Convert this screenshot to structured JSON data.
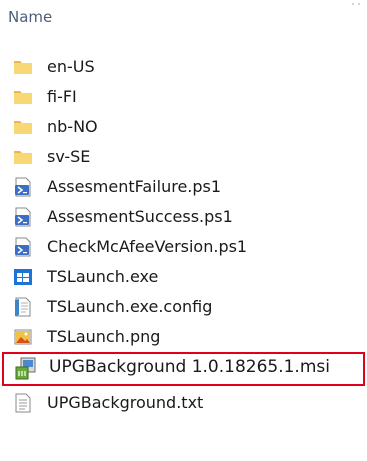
{
  "header": {
    "name_label": "Name"
  },
  "files": [
    {
      "name": "en-US",
      "icon": "folder-icon"
    },
    {
      "name": "fi-FI",
      "icon": "folder-icon"
    },
    {
      "name": "nb-NO",
      "icon": "folder-icon"
    },
    {
      "name": "sv-SE",
      "icon": "folder-icon"
    },
    {
      "name": "AssesmentFailure.ps1",
      "icon": "powershell-script-icon"
    },
    {
      "name": "AssesmentSuccess.ps1",
      "icon": "powershell-script-icon"
    },
    {
      "name": "CheckMcAfeeVersion.ps1",
      "icon": "powershell-script-icon"
    },
    {
      "name": "TSLaunch.exe",
      "icon": "windows-app-icon"
    },
    {
      "name": "TSLaunch.exe.config",
      "icon": "config-file-icon"
    },
    {
      "name": "TSLaunch.png",
      "icon": "image-file-icon"
    },
    {
      "name": "UPGBackground 1.0.18265.1.msi",
      "icon": "msi-installer-icon",
      "highlighted": true
    },
    {
      "name": "UPGBackground.txt",
      "icon": "text-file-icon"
    }
  ],
  "colors": {
    "highlight_border": "#e00019",
    "folder": "#f8d775",
    "header_text": "#4c607a"
  }
}
